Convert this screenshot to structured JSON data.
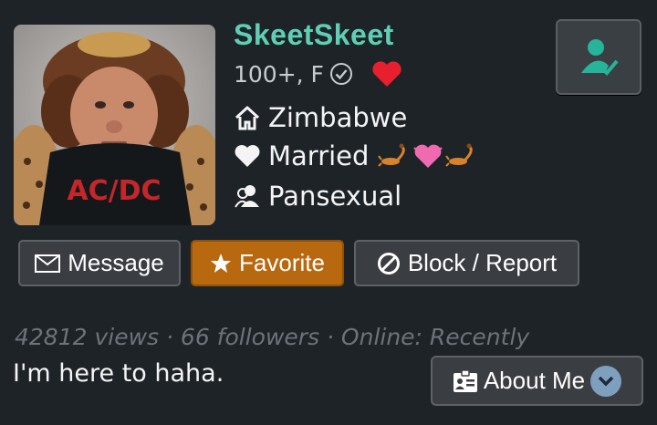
{
  "profile": {
    "username": "SkeetSkeet",
    "age_gender": "100+, F",
    "location": "Zimbabwe",
    "relationship": "Married",
    "orientation": "Pansexual",
    "avatar_shirt_text": "AC/DC"
  },
  "actions": {
    "message_label": "Message",
    "favorite_label": "Favorite",
    "block_label": "Block / Report"
  },
  "stats": {
    "text": "42812 views · 66 followers · Online: Recently"
  },
  "bio": {
    "text": "I'm here to haha.",
    "about_label": "About Me"
  },
  "icons": {
    "follow": "user-check-icon",
    "verified": "check-circle-icon",
    "like": "heart-icon",
    "location": "home-icon",
    "relationship": "heart-icon",
    "orientation": "users-icon",
    "message": "envelope-icon",
    "favorite": "star-icon",
    "block": "ban-icon",
    "about": "id-card-icon",
    "expand": "chevron-down-icon"
  },
  "colors": {
    "username": "#5fcfb4",
    "favorite_button": "#b8680f",
    "like_heart": "#e8202e",
    "follow_icon": "#26b49a",
    "background": "#1e2328"
  }
}
